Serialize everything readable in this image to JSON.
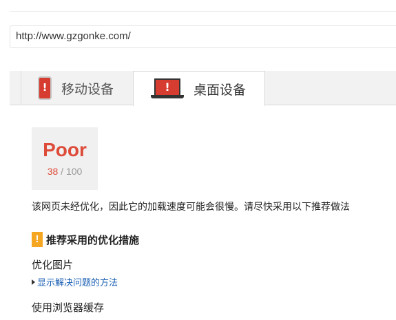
{
  "url_bar": {
    "value": "http://www.gzgonke.com/"
  },
  "tabs": [
    {
      "label": "移动设备",
      "icon": "mobile-warning-icon",
      "active": false
    },
    {
      "label": "桌面设备",
      "icon": "desktop-warning-icon",
      "active": true
    }
  ],
  "score": {
    "rating": "Poor",
    "value": "38",
    "separator": " / ",
    "max": "100",
    "color": "#dd4b39"
  },
  "summary": "该网页未经优化，因此它的加载速度可能会很慢。请尽快采用以下推荐做法",
  "recommendations": {
    "heading": "推荐采用的优化措施",
    "icon": "warning-icon",
    "icon_color": "#f5a623",
    "items": [
      {
        "title": "优化图片",
        "link": "显示解决问题的方法"
      },
      {
        "title": "使用浏览器缓存"
      }
    ]
  }
}
